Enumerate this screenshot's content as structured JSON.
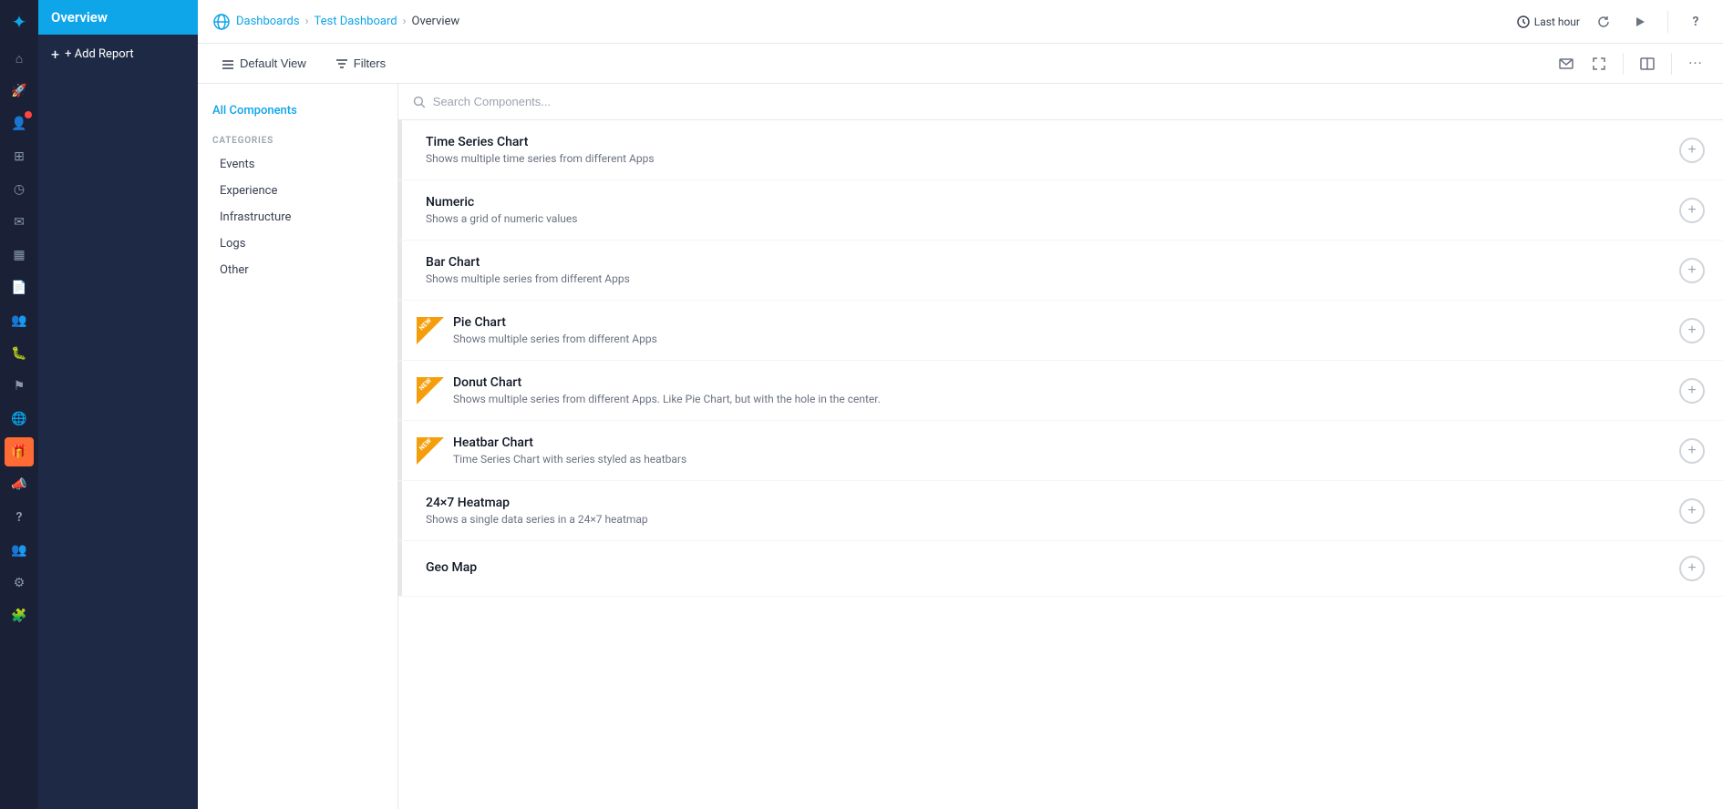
{
  "iconBar": {
    "items": [
      {
        "name": "home-icon",
        "glyph": "⌂",
        "active": false
      },
      {
        "name": "rocket-icon",
        "glyph": "🚀",
        "active": false
      },
      {
        "name": "user-icon",
        "glyph": "👤",
        "active": false,
        "badge": true
      },
      {
        "name": "grid-icon",
        "glyph": "⊞",
        "active": false
      },
      {
        "name": "clock-icon",
        "glyph": "◷",
        "active": false
      },
      {
        "name": "envelope-icon",
        "glyph": "✉",
        "active": false
      },
      {
        "name": "chart-icon",
        "glyph": "▦",
        "active": false
      },
      {
        "name": "document-icon",
        "glyph": "📄",
        "active": false
      },
      {
        "name": "people-icon",
        "glyph": "👥",
        "active": false
      },
      {
        "name": "bug-icon",
        "glyph": "🐛",
        "active": false
      },
      {
        "name": "flag-icon",
        "glyph": "⚑",
        "active": false
      },
      {
        "name": "globe2-icon",
        "glyph": "🌐",
        "active": true
      },
      {
        "name": "gift-icon",
        "glyph": "🎁",
        "active": false,
        "special": true
      },
      {
        "name": "megaphone-icon",
        "glyph": "📣",
        "active": false
      },
      {
        "name": "question-icon",
        "glyph": "?",
        "active": false
      },
      {
        "name": "users-icon",
        "glyph": "👥",
        "active": false
      },
      {
        "name": "settings-icon",
        "glyph": "⚙",
        "active": false
      },
      {
        "name": "puzzle-icon",
        "glyph": "🧩",
        "active": false
      }
    ]
  },
  "sidebar": {
    "activeLabel": "Overview",
    "addReportLabel": "+ Add Report"
  },
  "topbar": {
    "dashboardsLabel": "Dashboards",
    "testDashboardLabel": "Test Dashboard",
    "currentPageLabel": "Overview",
    "timeLabel": "Last hour",
    "separator1": "›",
    "separator2": "›"
  },
  "toolbar": {
    "defaultViewLabel": "Default View",
    "filtersLabel": "Filters"
  },
  "leftPanel": {
    "allComponentsLabel": "All Components",
    "categoriesLabel": "CATEGORIES",
    "categories": [
      {
        "label": "Events"
      },
      {
        "label": "Experience"
      },
      {
        "label": "Infrastructure"
      },
      {
        "label": "Logs"
      },
      {
        "label": "Other"
      }
    ]
  },
  "search": {
    "placeholder": "Search Components..."
  },
  "components": [
    {
      "name": "Time Series Chart",
      "desc": "Shows multiple time series from different Apps",
      "isNew": false
    },
    {
      "name": "Numeric",
      "desc": "Shows a grid of numeric values",
      "isNew": false
    },
    {
      "name": "Bar Chart",
      "desc": "Shows multiple series from different Apps",
      "isNew": false
    },
    {
      "name": "Pie Chart",
      "desc": "Shows multiple series from different Apps",
      "isNew": true
    },
    {
      "name": "Donut Chart",
      "desc": "Shows multiple series from different Apps. Like Pie Chart, but with the hole in the center.",
      "isNew": true
    },
    {
      "name": "Heatbar Chart",
      "desc": "Time Series Chart with series styled as heatbars",
      "isNew": true
    },
    {
      "name": "24×7 Heatmap",
      "desc": "Shows a single data series in a 24×7 heatmap",
      "isNew": false
    },
    {
      "name": "Geo Map",
      "desc": "",
      "isNew": false
    }
  ]
}
